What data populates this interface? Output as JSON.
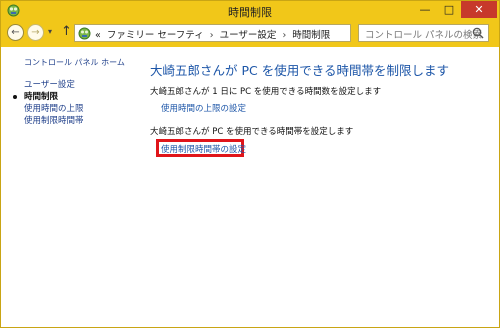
{
  "window": {
    "title": "時間制限",
    "controls": {
      "minimize": "—",
      "maximize": "□",
      "close": "✕"
    },
    "icon": "control-panel-icon"
  },
  "nav": {
    "back": "←",
    "forward": "→",
    "up": "↑",
    "dropdown": "▾",
    "breadcrumb_prefix": "«",
    "breadcrumbs": [
      "ファミリー セーフティ",
      "ユーザー設定",
      "時間制限"
    ],
    "separator": "›",
    "refresh": "↻",
    "search_placeholder": "コントロール パネルの検索"
  },
  "sidebar": {
    "home": "コントロール パネル ホーム",
    "items": [
      {
        "label": "ユーザー設定"
      },
      {
        "label": "時間制限",
        "current": true
      },
      {
        "label": "使用時間の上限"
      },
      {
        "label": "使用制限時間帯"
      }
    ]
  },
  "main": {
    "title": "大崎五郎さんが PC を使用できる時間帯を制限します",
    "section1_desc": "大崎五郎さんが 1 日に PC を使用できる時間数を設定します",
    "section1_link": "使用時間の上限の設定",
    "section2_desc": "大崎五郎さんが PC を使用できる時間帯を設定します",
    "section2_link": "使用制限時間帯の設定"
  },
  "colors": {
    "titlebar": "#f1c719",
    "link": "#1d56a8",
    "highlight": "#e0151a",
    "close_button": "#c7392b"
  }
}
